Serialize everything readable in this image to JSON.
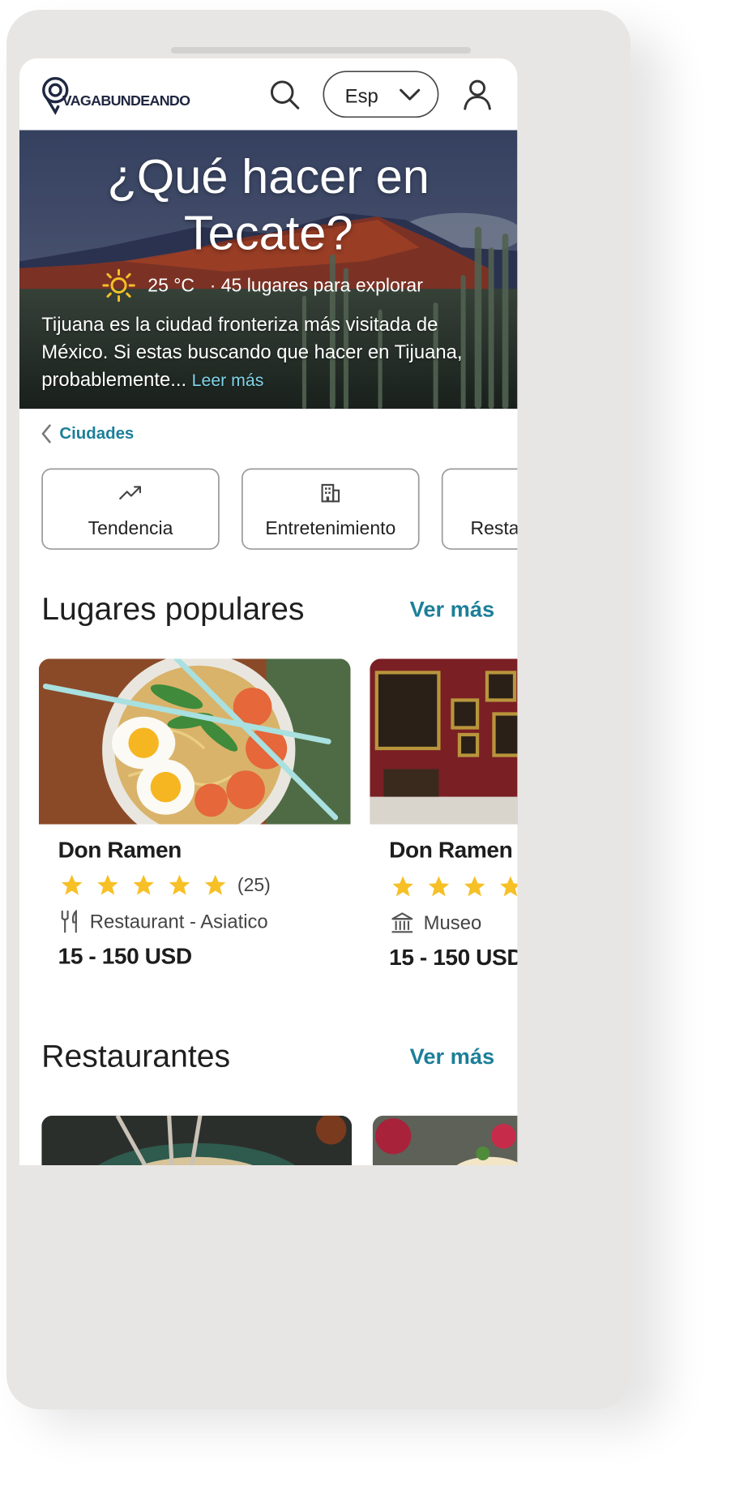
{
  "header": {
    "logo_text": "VAGABUNDEANDO",
    "language": "Esp"
  },
  "hero": {
    "title_line1": "¿Qué hacer en",
    "title_line2": "Tecate?",
    "temperature": "25 °C",
    "places": "· 45 lugares para explorar",
    "description": "Tijuana es la ciudad fronteriza más visitada de México. Si estas buscando que hacer en Tijuana, probablemente... ",
    "read_more": "Leer más"
  },
  "breadcrumb": {
    "label": "Ciudades"
  },
  "categories": [
    {
      "label": "Tendencia",
      "icon": "trending-up-icon"
    },
    {
      "label": "Entretenimiento",
      "icon": "building-icon"
    },
    {
      "label": "Resta"
    }
  ],
  "popular": {
    "title": "Lugares populares",
    "more": "Ver más",
    "cards": [
      {
        "name": "Don Ramen",
        "rating_stars": 5,
        "rating_count": "(25)",
        "type": "Restaurant - Asiatico",
        "type_icon": "fork-knife-icon",
        "price": "15 - 150 USD"
      },
      {
        "name": "Don Ramen",
        "rating_stars": 5,
        "type": "Museo",
        "type_icon": "museum-icon",
        "price": "15 - 150 USD"
      }
    ]
  },
  "restaurants": {
    "title": "Restaurantes",
    "more": "Ver más"
  },
  "colors": {
    "accent": "#1c7f99",
    "star": "#f6c026",
    "text": "#1f1f1f"
  }
}
